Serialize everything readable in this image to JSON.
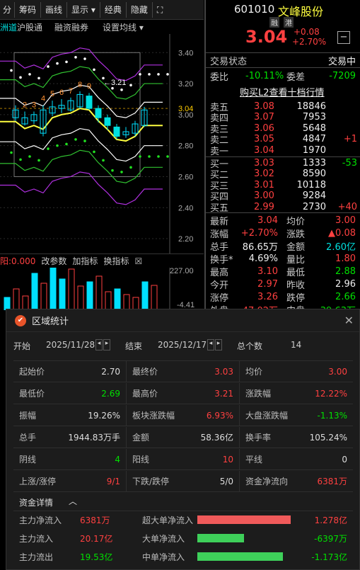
{
  "toolbar": {
    "items": [
      "分",
      "筹码",
      "画线",
      "显示 ▾",
      "经典",
      "隐藏"
    ],
    "expand": "⛶"
  },
  "subbar": {
    "left": "洲道",
    "board": "沪股通",
    "margin": "融资融券",
    "ma": "设置均线 ▾"
  },
  "kline": {
    "prices": [
      "3.40",
      "3.20",
      "3.00",
      "2.80",
      "2.60",
      "2.40",
      "2.20"
    ],
    "current_tag": "3.04",
    "high_label": "3.21",
    "wave_labels": [
      "2",
      "3",
      "4",
      "5",
      "6",
      "7",
      "8",
      "9"
    ],
    "candles": [
      [
        2.98,
        3.03,
        2.96,
        3.06
      ],
      [
        2.94,
        2.98,
        2.93,
        3.02
      ],
      [
        2.96,
        3.0,
        2.94,
        3.02
      ],
      [
        2.88,
        3.03,
        2.86,
        3.06
      ],
      [
        3.01,
        3.05,
        2.99,
        3.09
      ],
      [
        3.04,
        3.06,
        3.01,
        3.1
      ],
      [
        3.03,
        3.09,
        3.02,
        3.11
      ],
      [
        3.05,
        3.13,
        3.04,
        3.15
      ],
      [
        3.12,
        3.04,
        3.03,
        3.14
      ],
      [
        3.04,
        2.98,
        2.95,
        3.06
      ],
      [
        2.98,
        2.93,
        2.9,
        3.0
      ],
      [
        2.92,
        2.86,
        2.84,
        2.94
      ],
      [
        2.87,
        2.89,
        2.85,
        2.92
      ],
      [
        2.88,
        2.94,
        2.86,
        2.96
      ],
      [
        2.93,
        3.03,
        2.92,
        3.05
      ]
    ]
  },
  "indicator": {
    "label": "阳:0.000",
    "params": "改参数",
    "add": "加指标",
    "switch": "换指标",
    "close": "☒",
    "scale_top": "227.00",
    "scale_bottom": "-4.41"
  },
  "quote": {
    "code": "601010",
    "name": "文峰股份",
    "tags": [
      "融",
      "港"
    ],
    "price": "3.04",
    "change": "+0.08",
    "pct": "+2.70%",
    "minus": "−"
  },
  "status": {
    "label": "交易状态",
    "value": "交易中"
  },
  "ratio": {
    "wb_label": "委比",
    "wb": "-10.11%",
    "wc_label": "委差",
    "wc": "-7209"
  },
  "l2": "购买L2查看十档行情",
  "asks": [
    {
      "n": "卖五",
      "p": "3.08",
      "v": "18846",
      "d": ""
    },
    {
      "n": "卖四",
      "p": "3.07",
      "v": "7953",
      "d": ""
    },
    {
      "n": "卖三",
      "p": "3.06",
      "v": "5648",
      "d": ""
    },
    {
      "n": "卖二",
      "p": "3.05",
      "v": "4847",
      "d": "+1"
    },
    {
      "n": "卖一",
      "p": "3.04",
      "v": "1970",
      "d": ""
    }
  ],
  "bids": [
    {
      "n": "买一",
      "p": "3.03",
      "v": "1333",
      "d": "-53"
    },
    {
      "n": "买二",
      "p": "3.02",
      "v": "8590",
      "d": ""
    },
    {
      "n": "买三",
      "p": "3.01",
      "v": "10118",
      "d": ""
    },
    {
      "n": "买四",
      "p": "3.00",
      "v": "9284",
      "d": ""
    },
    {
      "n": "买五",
      "p": "2.99",
      "v": "2730",
      "d": "+40"
    }
  ],
  "stats": [
    {
      "a": "最新",
      "av": "3.04",
      "b": "均价",
      "bv": "3.00"
    },
    {
      "a": "涨幅",
      "av": "+2.70%",
      "b": "涨跌",
      "bv": "▲0.08"
    },
    {
      "a": "总手",
      "av": "86.65万",
      "b": "金额",
      "bv": "2.60亿"
    },
    {
      "a": "换手*",
      "av": "4.69%",
      "b": "量比",
      "bv": "1.80"
    },
    {
      "a": "最高",
      "av": "3.10",
      "b": "最低",
      "bv": "2.88"
    },
    {
      "a": "今开",
      "av": "2.97",
      "b": "昨收",
      "bv": "2.96"
    },
    {
      "a": "涨停",
      "av": "3.26",
      "b": "跌停",
      "bv": "2.66"
    },
    {
      "a": "外盘",
      "av": "47.02万",
      "b": "内盘",
      "bv": "39.63万"
    }
  ],
  "dialog": {
    "title": "区域统计",
    "close": "✕",
    "start_label": "开始",
    "start": "2025/11/28",
    "end_label": "结束",
    "end": "2025/12/17",
    "count_label": "总个数",
    "count": "14",
    "cells": [
      [
        "起始价",
        "2.70",
        "最终价",
        "3.03",
        "均价",
        "3.00"
      ],
      [
        "最低价",
        "2.69",
        "最高价",
        "3.21",
        "涨跌幅",
        "12.22%"
      ],
      [
        "振幅",
        "19.26%",
        "板块涨跌幅",
        "6.93%",
        "大盘涨跌幅",
        "-1.13%"
      ],
      [
        "总手",
        "1944.83万手",
        "金额",
        "58.36亿",
        "换手率",
        "105.24%"
      ],
      [
        "阴线",
        "4",
        "阳线",
        "10",
        "平线",
        "0"
      ],
      [
        "上涨/涨停",
        "9/1",
        "下跌/跌停",
        "5/0",
        "资金净流向",
        "6381万"
      ]
    ],
    "fund_title": "资金详情",
    "fund_toggle": "︿",
    "fund_left": [
      [
        "主力净流入",
        "6381万"
      ],
      [
        "主力流入",
        "20.17亿"
      ],
      [
        "主力流出",
        "19.53亿"
      ]
    ],
    "fund_right": [
      {
        "l": "超大单净流入",
        "v": "1.278亿",
        "frac": 1.0
      },
      {
        "l": "大单净流入",
        "v": "-6397万",
        "frac": 0.5
      },
      {
        "l": "中单净流入",
        "v": "-1.173亿",
        "frac": 0.92
      }
    ]
  }
}
